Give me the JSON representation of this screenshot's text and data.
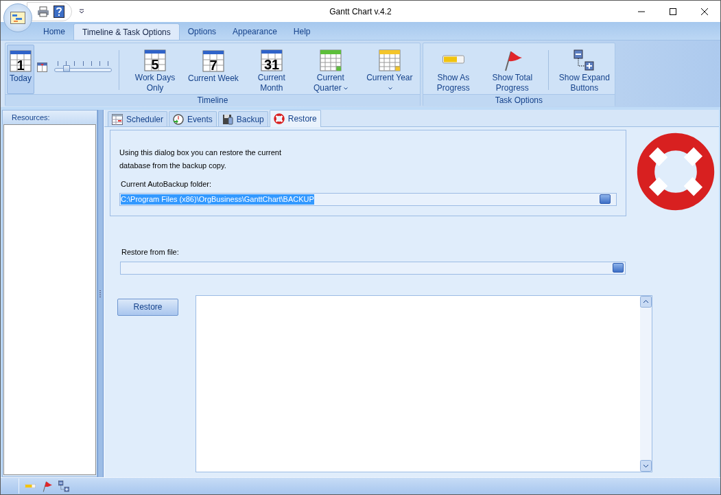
{
  "window": {
    "title": "Gantt Chart v.4.2"
  },
  "ribbon_tabs": [
    {
      "label": "Home",
      "selected": false
    },
    {
      "label": "Timeline & Task Options",
      "selected": true
    },
    {
      "label": "Options",
      "selected": false
    },
    {
      "label": "Appearance",
      "selected": false
    },
    {
      "label": "Help",
      "selected": false
    }
  ],
  "ribbon_groups": [
    {
      "label": "Timeline",
      "items": [
        {
          "kind": "button",
          "label": "Today",
          "icon_text": "1",
          "selected": true
        },
        {
          "kind": "slider",
          "level": 0.17
        },
        {
          "kind": "separator"
        },
        {
          "kind": "button",
          "label": "Work Days Only",
          "icon_text": "5",
          "selected": false
        },
        {
          "kind": "button",
          "label": "Current Week",
          "icon_text": "7",
          "selected": false
        },
        {
          "kind": "button",
          "label": "Current Month",
          "icon_text": "31",
          "selected": false
        },
        {
          "kind": "button",
          "label": "Current Quarter",
          "dropdown": true,
          "selected": false
        },
        {
          "kind": "button",
          "label": "Current Year",
          "dropdown": true,
          "selected": false
        }
      ]
    },
    {
      "label": "Task Options",
      "items": [
        {
          "kind": "button",
          "label": "Show As Progress",
          "selected": false
        },
        {
          "kind": "button",
          "label": "Show Total Progress",
          "selected": false
        },
        {
          "kind": "separator"
        },
        {
          "kind": "button",
          "label": "Show Expand Buttons",
          "selected": false
        }
      ]
    }
  ],
  "resources": {
    "label": "Resources:"
  },
  "doc_tabs": [
    {
      "label": "Scheduler",
      "selected": false
    },
    {
      "label": "Events",
      "selected": false
    },
    {
      "label": "Backup",
      "selected": false
    },
    {
      "label": "Restore",
      "selected": true
    }
  ],
  "restore": {
    "intro": "Using this dialog box you can restore the current database from the backup copy.",
    "folder_label": "Current AutoBackup folder:",
    "folder_value": "C:\\Program Files (x86)\\OrgBusiness\\GanttChart\\BACKUP",
    "file_label": "Restore from file:",
    "button": "Restore"
  }
}
